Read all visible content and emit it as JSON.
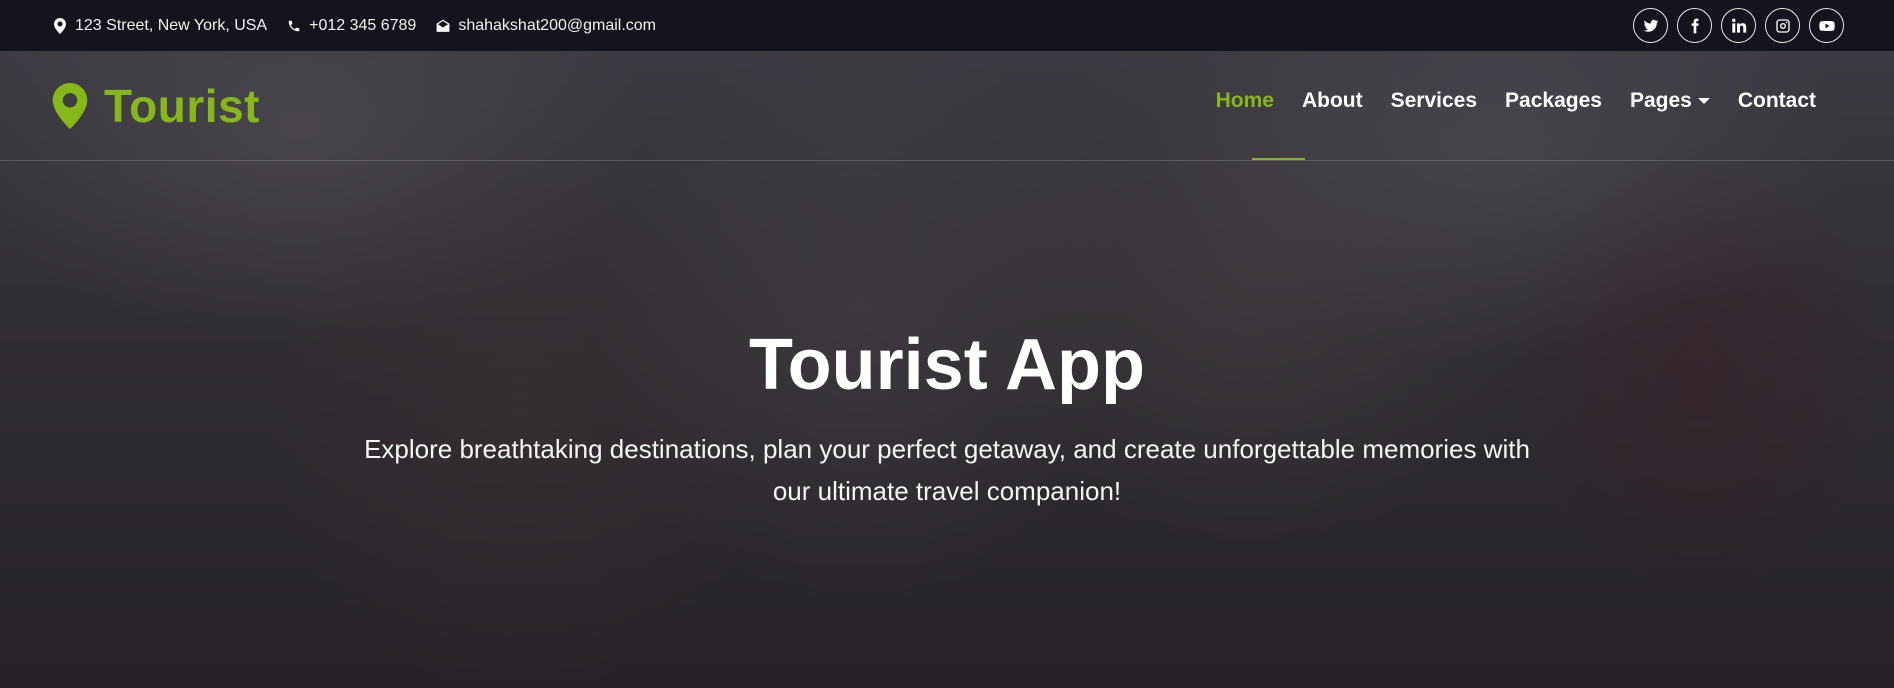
{
  "topbar": {
    "address": "123 Street, New York, USA",
    "phone": "+012 345 6789",
    "email": "shahakshat200@gmail.com",
    "socials": [
      "twitter-icon",
      "facebook-icon",
      "linkedin-icon",
      "instagram-icon",
      "youtube-icon"
    ]
  },
  "navbar": {
    "brand": "Tourist",
    "menu": [
      "Home",
      "About",
      "Services",
      "Packages",
      "Pages",
      "Contact"
    ],
    "active": "Home"
  },
  "hero": {
    "title": "Tourist App",
    "subtitle": "Explore breathtaking destinations, plan your perfect getaway, and create unforgettable memories with our ultimate travel companion!"
  },
  "colors": {
    "accent": "#86b817",
    "topbar_bg": "#14141f"
  }
}
